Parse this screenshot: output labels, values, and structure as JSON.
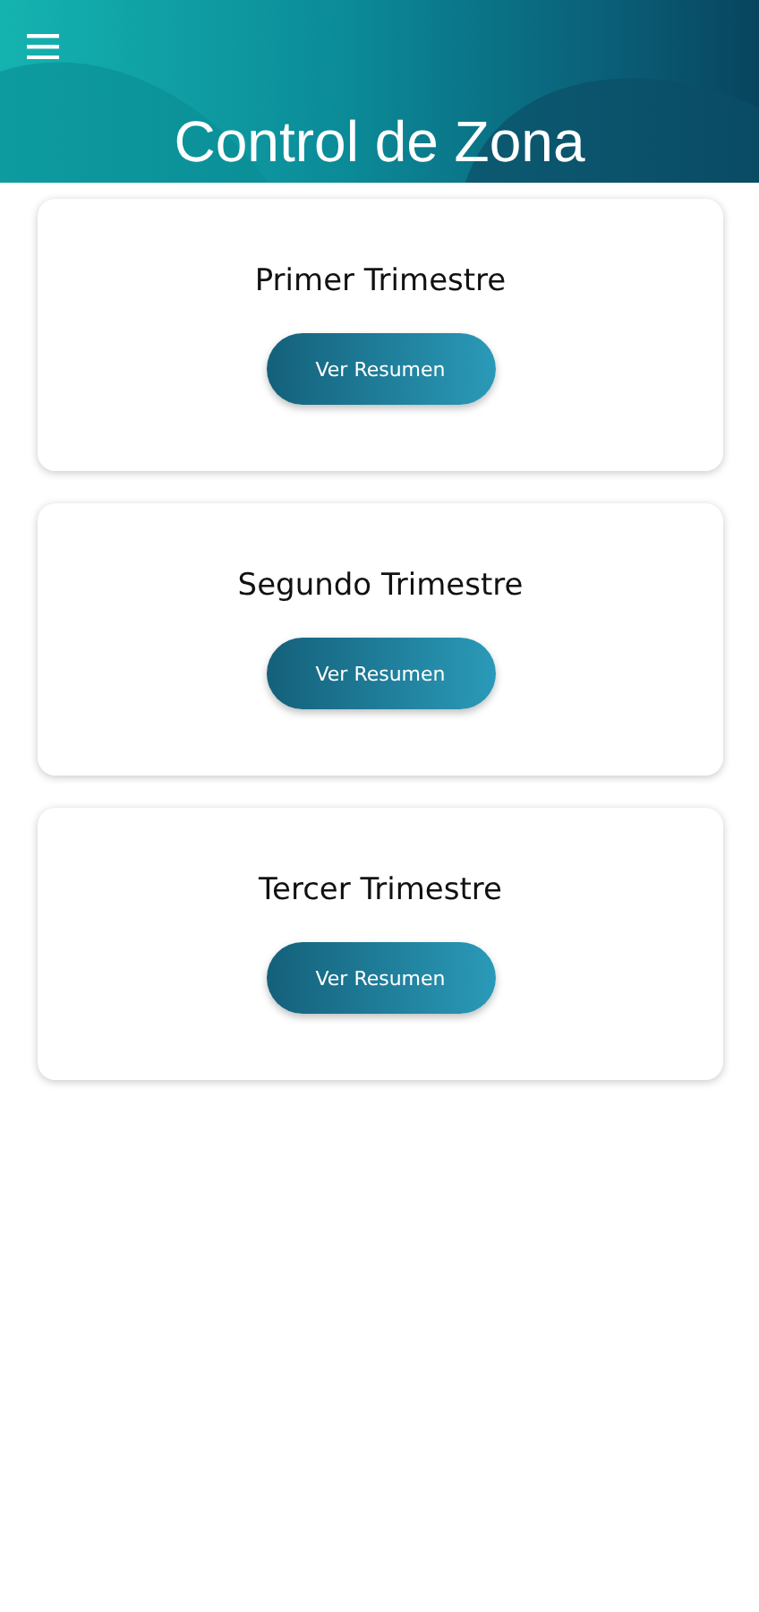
{
  "header": {
    "title": "Control de Zona"
  },
  "cards": [
    {
      "title": "Primer Trimestre",
      "button": "Ver Resumen"
    },
    {
      "title": "Segundo Trimestre",
      "button": "Ver Resumen"
    },
    {
      "title": "Tercer Trimestre",
      "button": "Ver Resumen"
    }
  ]
}
